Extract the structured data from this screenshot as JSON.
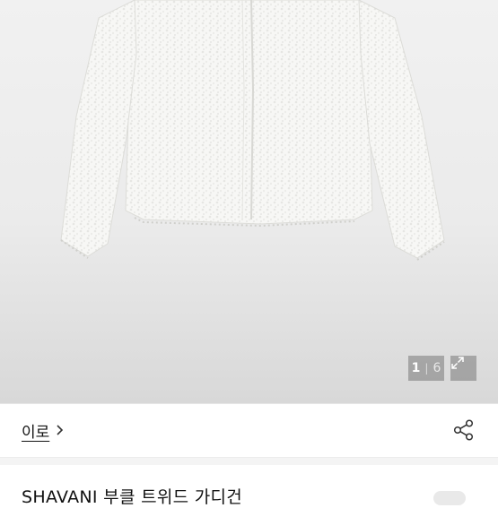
{
  "image": {
    "alt": "white tweed cardigan",
    "counter_current": "1",
    "counter_separator": "|",
    "counter_total": "6"
  },
  "brand": {
    "name": "이로"
  },
  "product": {
    "title": "SHAVANI 부클 트위드 가디건"
  },
  "icons": {
    "expand": "expand-icon",
    "chevron": "chevron-right-icon",
    "share": "share-icon"
  },
  "colors": {
    "background": "#ffffff",
    "overlay": "#787878",
    "text": "#111111",
    "divider": "#f4f4f4"
  }
}
